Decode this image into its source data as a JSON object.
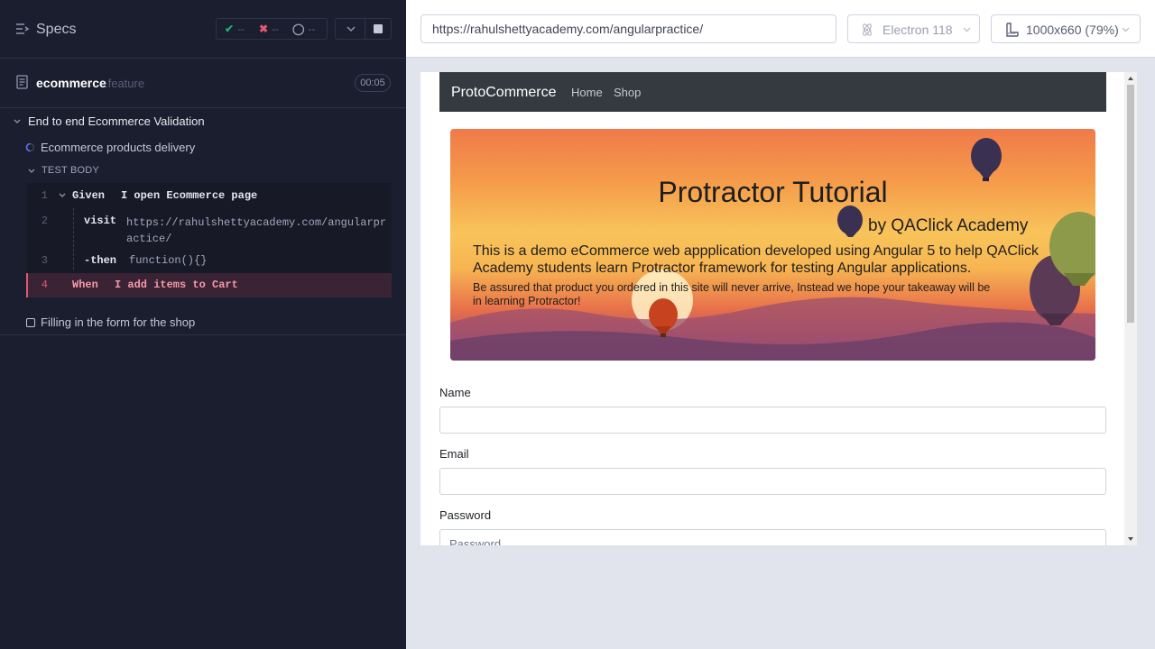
{
  "reporter": {
    "title": "Specs",
    "stats": {
      "passed": "--",
      "failed": "--",
      "pending": "--"
    },
    "spec": {
      "name": "ecommerce",
      "ext": ".feature",
      "duration": "00:05"
    },
    "suite": {
      "title": "End to end Ecommerce Validation",
      "tests": [
        {
          "title": "Ecommerce products delivery",
          "state": "running"
        },
        {
          "title": "Filling in the form for the shop",
          "state": "pending"
        }
      ],
      "body_label": "TEST BODY",
      "commands": [
        {
          "num": "1",
          "keyword": "Given",
          "text": "I open Ecommerce page"
        },
        {
          "num": "2",
          "keyword": "visit",
          "text": "https://rahulshettyacademy.com/angularpractice/"
        },
        {
          "num": "3",
          "keyword": "-then",
          "text": "function(){}"
        },
        {
          "num": "4",
          "keyword": "When",
          "text": "I add items to Cart"
        }
      ]
    }
  },
  "aut": {
    "url": "https://rahulshettyacademy.com/angularpractice/",
    "browser": "Electron 118",
    "viewport": "1000x660  (79%)",
    "page": {
      "brand": "ProtoCommerce",
      "nav": [
        "Home",
        "Shop"
      ],
      "hero_title": "Protractor Tutorial",
      "hero_sub": "by QAClick Academy",
      "hero_desc": "This is a demo eCommerce web appplication developed using Angular 5 to help QAClick Academy students learn Protractor framework for testing Angular applications.",
      "hero_note": "Be assured that product you ordered in this site will never arrive, Instead we hope your takeaway will be in learning Protractor!",
      "form": {
        "name_label": "Name",
        "email_label": "Email",
        "password_label": "Password",
        "password_placeholder": "Password"
      }
    }
  },
  "colors": {
    "reporter_bg": "#1b1e2e",
    "pass": "#1fa971",
    "fail": "#e45770",
    "running": "#6470f3",
    "navbar": "#343a40"
  },
  "icons": [
    "specs-list-icon",
    "check-icon",
    "x-icon",
    "spinner-icon",
    "chevron-down-icon",
    "stop-icon",
    "file-icon",
    "electron-icon",
    "ruler-icon"
  ]
}
